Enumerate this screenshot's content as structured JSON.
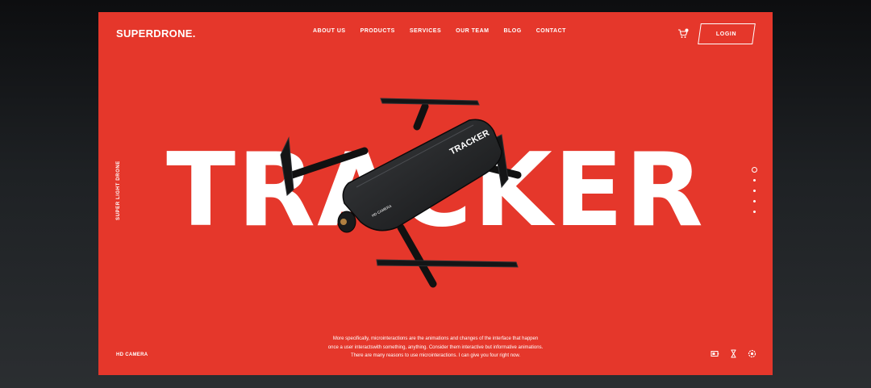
{
  "brand": {
    "logo": "SUPERDRONE."
  },
  "nav": {
    "items": [
      "ABOUT US",
      "PRODUCTS",
      "SERVICES",
      "OUR TEAM",
      "BLOG",
      "CONTACT"
    ]
  },
  "header": {
    "login_label": "LOGIN"
  },
  "hero": {
    "title": "TRACKER",
    "side_label": "SUPER LIGHT DRONE",
    "drone_text": "TRACKER",
    "camera_text": "HD CAMERA"
  },
  "footer": {
    "left_label": "HD CAMERA",
    "description": [
      "More specifically, microinteractions are the animations and changes of the interface that happen",
      "once a user interactswith something, anything. Consider them interactive but informative animations.",
      "There are many reasons to use microinteractions. I can give you four right now."
    ]
  },
  "slider": {
    "count": 5,
    "active": 0
  },
  "icons": [
    "cart-icon",
    "battery-icon",
    "hourglass-icon",
    "settings-icon"
  ],
  "colors": {
    "card": "#e5372b",
    "drone": "#1f2022"
  }
}
